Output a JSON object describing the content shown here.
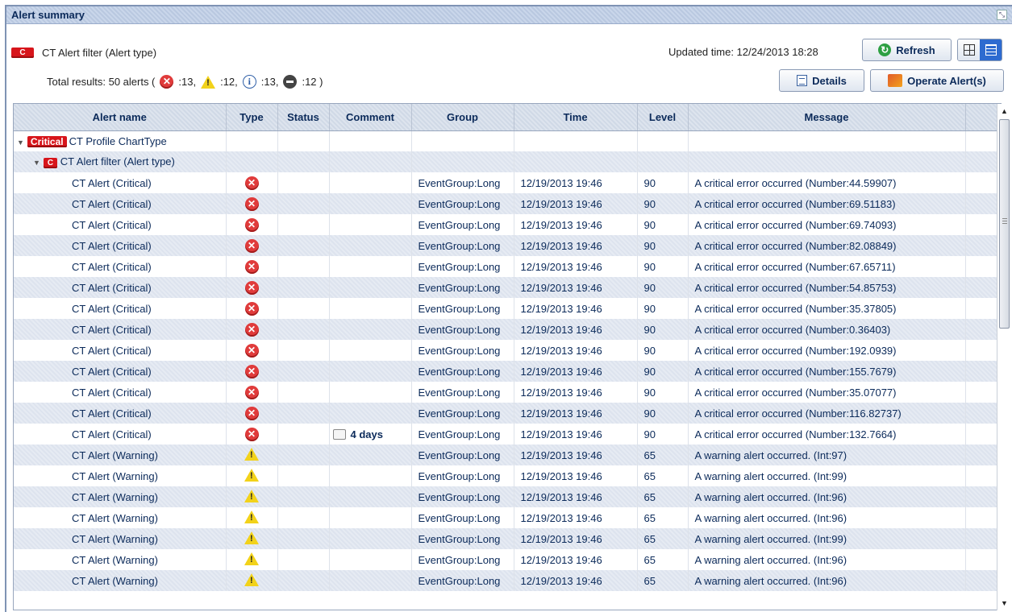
{
  "panel": {
    "title": "Alert summary"
  },
  "filter": {
    "badge": "C",
    "label": "CT Alert filter (Alert type)"
  },
  "updated_time": "Updated time: 12/24/2013 18:28",
  "buttons": {
    "refresh": "Refresh",
    "details": "Details",
    "operate": "Operate Alert(s)"
  },
  "totals": {
    "prefix": "Total results: 50 alerts (",
    "critical": ":13,",
    "warning": ":12,",
    "info": ":13,",
    "unknown": ":12 )"
  },
  "columns": [
    "Alert name",
    "Type",
    "Status",
    "Comment",
    "Group",
    "Time",
    "Level",
    "Message"
  ],
  "tree": {
    "root_badge": "Critical",
    "root_label": "CT Profile ChartType",
    "child_badge": "C",
    "child_label": "CT Alert filter (Alert type)"
  },
  "rows": [
    {
      "name": "CT Alert (Critical)",
      "type": "critical",
      "comment": "",
      "group": "EventGroup:Long",
      "time": "12/19/2013 19:46",
      "level": "90",
      "message": "A critical error occurred (Number:44.59907)"
    },
    {
      "name": "CT Alert (Critical)",
      "type": "critical",
      "comment": "",
      "group": "EventGroup:Long",
      "time": "12/19/2013 19:46",
      "level": "90",
      "message": "A critical error occurred (Number:69.51183)"
    },
    {
      "name": "CT Alert (Critical)",
      "type": "critical",
      "comment": "",
      "group": "EventGroup:Long",
      "time": "12/19/2013 19:46",
      "level": "90",
      "message": "A critical error occurred (Number:69.74093)"
    },
    {
      "name": "CT Alert (Critical)",
      "type": "critical",
      "comment": "",
      "group": "EventGroup:Long",
      "time": "12/19/2013 19:46",
      "level": "90",
      "message": "A critical error occurred (Number:82.08849)"
    },
    {
      "name": "CT Alert (Critical)",
      "type": "critical",
      "comment": "",
      "group": "EventGroup:Long",
      "time": "12/19/2013 19:46",
      "level": "90",
      "message": "A critical error occurred (Number:67.65711)"
    },
    {
      "name": "CT Alert (Critical)",
      "type": "critical",
      "comment": "",
      "group": "EventGroup:Long",
      "time": "12/19/2013 19:46",
      "level": "90",
      "message": "A critical error occurred (Number:54.85753)"
    },
    {
      "name": "CT Alert (Critical)",
      "type": "critical",
      "comment": "",
      "group": "EventGroup:Long",
      "time": "12/19/2013 19:46",
      "level": "90",
      "message": "A critical error occurred (Number:35.37805)"
    },
    {
      "name": "CT Alert (Critical)",
      "type": "critical",
      "comment": "",
      "group": "EventGroup:Long",
      "time": "12/19/2013 19:46",
      "level": "90",
      "message": "A critical error occurred (Number:0.36403)"
    },
    {
      "name": "CT Alert (Critical)",
      "type": "critical",
      "comment": "",
      "group": "EventGroup:Long",
      "time": "12/19/2013 19:46",
      "level": "90",
      "message": "A critical error occurred (Number:192.0939)"
    },
    {
      "name": "CT Alert (Critical)",
      "type": "critical",
      "comment": "",
      "group": "EventGroup:Long",
      "time": "12/19/2013 19:46",
      "level": "90",
      "message": "A critical error occurred (Number:155.7679)"
    },
    {
      "name": "CT Alert (Critical)",
      "type": "critical",
      "comment": "",
      "group": "EventGroup:Long",
      "time": "12/19/2013 19:46",
      "level": "90",
      "message": "A critical error occurred (Number:35.07077)"
    },
    {
      "name": "CT Alert (Critical)",
      "type": "critical",
      "comment": "",
      "group": "EventGroup:Long",
      "time": "12/19/2013 19:46",
      "level": "90",
      "message": "A critical error occurred (Number:116.82737)"
    },
    {
      "name": "CT Alert (Critical)",
      "type": "critical",
      "comment": "4 days",
      "group": "EventGroup:Long",
      "time": "12/19/2013 19:46",
      "level": "90",
      "message": "A critical error occurred (Number:132.7664)"
    },
    {
      "name": "CT Alert (Warning)",
      "type": "warning",
      "comment": "",
      "group": "EventGroup:Long",
      "time": "12/19/2013 19:46",
      "level": "65",
      "message": "A warning alert occurred. (Int:97)"
    },
    {
      "name": "CT Alert (Warning)",
      "type": "warning",
      "comment": "",
      "group": "EventGroup:Long",
      "time": "12/19/2013 19:46",
      "level": "65",
      "message": "A warning alert occurred. (Int:99)"
    },
    {
      "name": "CT Alert (Warning)",
      "type": "warning",
      "comment": "",
      "group": "EventGroup:Long",
      "time": "12/19/2013 19:46",
      "level": "65",
      "message": "A warning alert occurred. (Int:96)"
    },
    {
      "name": "CT Alert (Warning)",
      "type": "warning",
      "comment": "",
      "group": "EventGroup:Long",
      "time": "12/19/2013 19:46",
      "level": "65",
      "message": "A warning alert occurred. (Int:96)"
    },
    {
      "name": "CT Alert (Warning)",
      "type": "warning",
      "comment": "",
      "group": "EventGroup:Long",
      "time": "12/19/2013 19:46",
      "level": "65",
      "message": "A warning alert occurred. (Int:99)"
    },
    {
      "name": "CT Alert (Warning)",
      "type": "warning",
      "comment": "",
      "group": "EventGroup:Long",
      "time": "12/19/2013 19:46",
      "level": "65",
      "message": "A warning alert occurred. (Int:96)"
    },
    {
      "name": "CT Alert (Warning)",
      "type": "warning",
      "comment": "",
      "group": "EventGroup:Long",
      "time": "12/19/2013 19:46",
      "level": "65",
      "message": "A warning alert occurred. (Int:96)"
    }
  ],
  "colors": {
    "critical": "#e03b3b",
    "warning": "#f2d21a",
    "text": "#0b2a5a"
  }
}
